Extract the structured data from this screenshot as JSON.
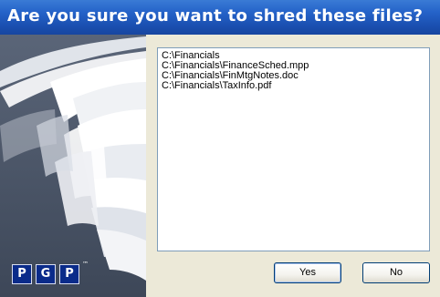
{
  "dialog": {
    "title": "Are you sure you want to shred these files?",
    "title_bar_color": "#2563c9"
  },
  "sidebar": {
    "background_color": "#4a5567",
    "logo_letters": [
      "P",
      "G",
      "P"
    ],
    "logo_trademark": "™"
  },
  "files": [
    "C:\\Financials",
    "C:\\Financials\\FinanceSched.mpp",
    "C:\\Financials\\FinMtgNotes.doc",
    "C:\\Financials\\TaxInfo.pdf"
  ],
  "buttons": {
    "yes_label": "Yes",
    "no_label": "No"
  }
}
